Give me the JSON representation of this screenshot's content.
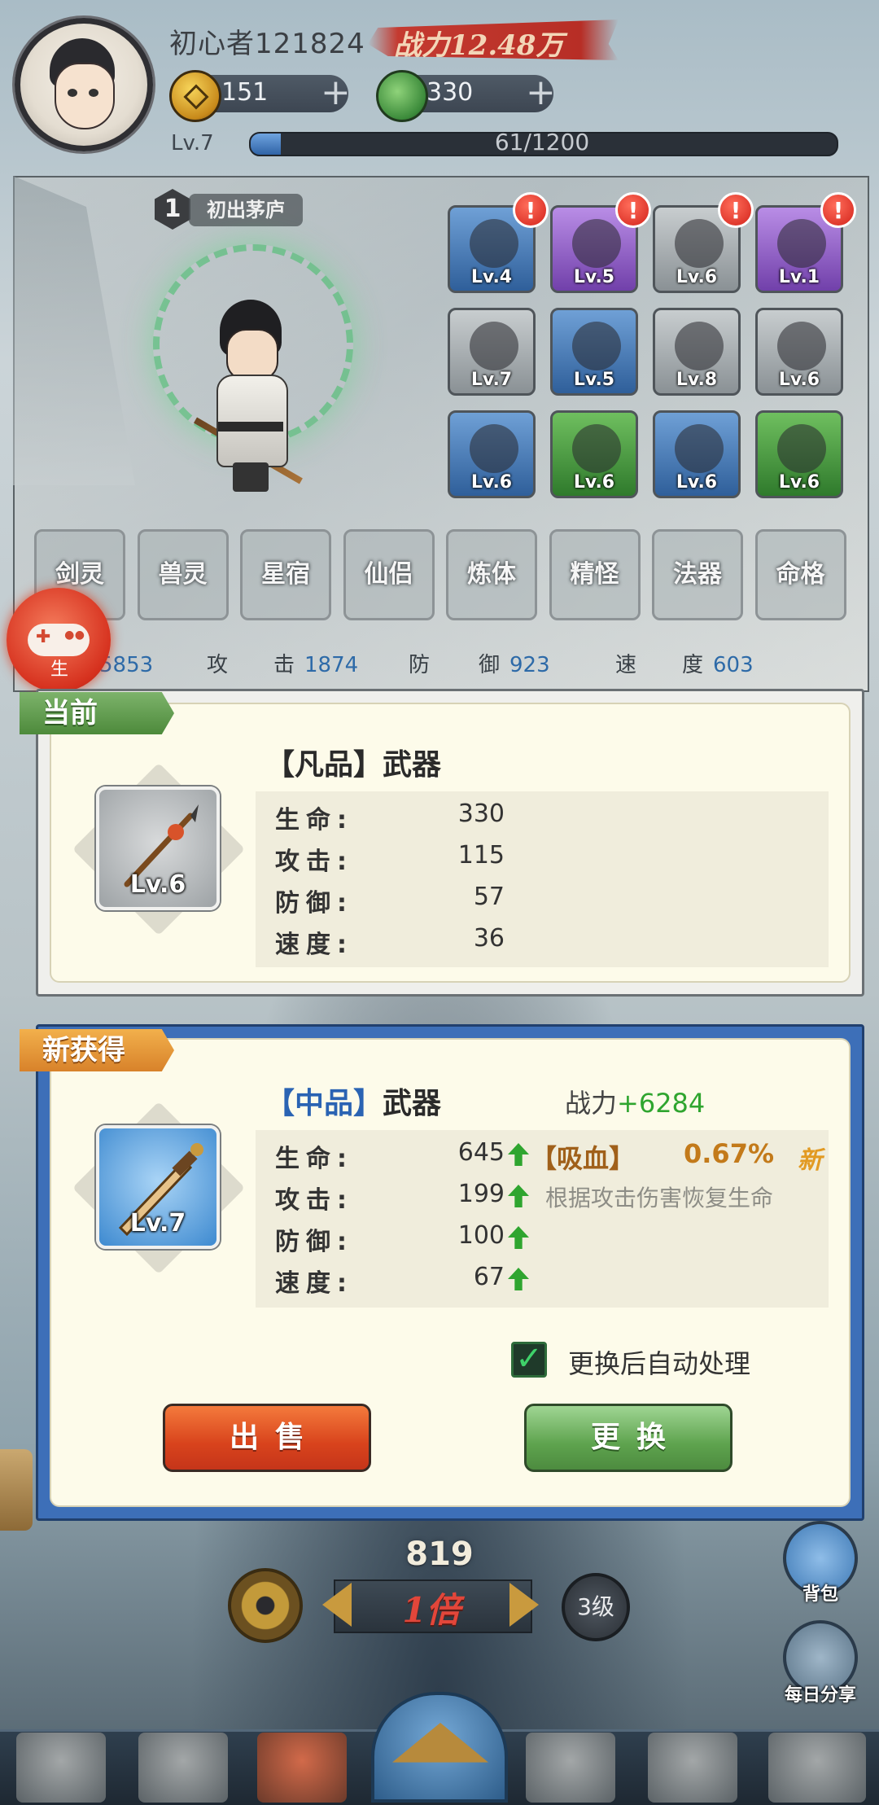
{
  "header": {
    "player_name": "初心者121824",
    "combat_power": "战力12.48万",
    "coins": "151",
    "jade": "330",
    "level_label": "Lv.7",
    "xp_text": "61/1200",
    "xp_progress": 0.051,
    "plus": "+"
  },
  "stage": {
    "number": "1",
    "name": "初出茅庐"
  },
  "equipment": [
    {
      "level": "Lv.4",
      "quality": "blue",
      "alert": true,
      "icon": "helmet-icon"
    },
    {
      "level": "Lv.5",
      "quality": "purple",
      "alert": true,
      "icon": "robe-icon"
    },
    {
      "level": "Lv.6",
      "quality": "gray",
      "alert": true,
      "icon": "spear-icon"
    },
    {
      "level": "Lv.1",
      "quality": "purple",
      "alert": true,
      "icon": "talisman-icon"
    },
    {
      "level": "Lv.7",
      "quality": "gray",
      "alert": false,
      "icon": "shoulder-icon"
    },
    {
      "level": "Lv.5",
      "quality": "blue",
      "alert": false,
      "icon": "necklace-icon"
    },
    {
      "level": "Lv.8",
      "quality": "gray",
      "alert": false,
      "icon": "bracer-icon"
    },
    {
      "level": "Lv.6",
      "quality": "gray",
      "alert": false,
      "icon": "glove-icon"
    },
    {
      "level": "Lv.6",
      "quality": "blue",
      "alert": false,
      "icon": "belt-icon"
    },
    {
      "level": "Lv.6",
      "quality": "green",
      "alert": false,
      "icon": "pants-icon"
    },
    {
      "level": "Lv.6",
      "quality": "blue",
      "alert": false,
      "icon": "ring-icon"
    },
    {
      "level": "Lv.6",
      "quality": "green",
      "alert": false,
      "icon": "boots-icon"
    }
  ],
  "alert_mark": "!",
  "functions": [
    "剑灵",
    "兽灵",
    "星宿",
    "仙侣",
    "炼体",
    "精怪",
    "法器",
    "命格"
  ],
  "hero_stats": [
    {
      "label": "命",
      "value": "5853"
    },
    {
      "label": "攻",
      "value": ""
    },
    {
      "label": "击",
      "value": "1874"
    },
    {
      "label": "防",
      "value": ""
    },
    {
      "label": "御",
      "value": "923"
    },
    {
      "label": "速",
      "value": ""
    },
    {
      "label": "度",
      "value": "603"
    }
  ],
  "bubble_text": "生",
  "current": {
    "tag": "当前",
    "title": "【凡品】武器",
    "item_level": "Lv.6",
    "stats": [
      {
        "label": "生命:",
        "value": "330"
      },
      {
        "label": "攻击:",
        "value": "115"
      },
      {
        "label": "防御:",
        "value": "57"
      },
      {
        "label": "速度:",
        "value": "36"
      }
    ]
  },
  "new_item": {
    "tag": "新获得",
    "title_quality": "【中品】",
    "title_type": "武器",
    "combat_label": "战力",
    "combat_delta": "+6284",
    "item_level": "Lv.7",
    "stats": [
      {
        "label": "生命:",
        "value": "645"
      },
      {
        "label": "攻击:",
        "value": "199"
      },
      {
        "label": "防御:",
        "value": "100"
      },
      {
        "label": "速度:",
        "value": "67"
      }
    ],
    "affix_name": "【吸血】",
    "affix_value": "0.67%",
    "affix_new": "新",
    "affix_desc": "根据攻击伤害恢复生命",
    "auto_process_label": "更换后自动处理",
    "auto_process_checked": true,
    "sell_label": "出售",
    "swap_label": "更换"
  },
  "battle": {
    "counter": "819",
    "speed": "1倍",
    "tier": "3级"
  },
  "side": {
    "bag_label": "背包",
    "share_label": "每日分享"
  },
  "colors": {
    "accent_blue": "#3d6fb8",
    "positive": "#2fa52f",
    "affix": "#a0601a"
  }
}
